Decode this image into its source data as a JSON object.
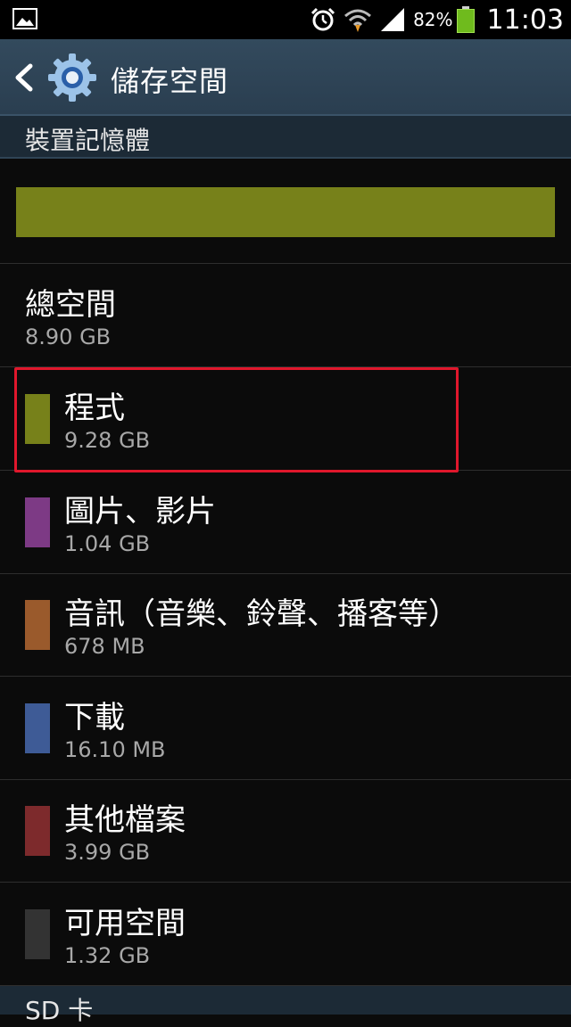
{
  "status_bar": {
    "battery_percent": "82%",
    "time": "11:03",
    "icons": [
      "image-icon",
      "alarm-icon",
      "wifi-icon",
      "signal-icon",
      "battery-icon"
    ]
  },
  "action_bar": {
    "title": "儲存空間",
    "icons": [
      "back-icon",
      "gear-icon"
    ]
  },
  "device_memory": {
    "header": "裝置記憶體",
    "usage_bar_color": "#77811a",
    "total": {
      "label": "總空間",
      "value": "8.90 GB"
    },
    "items": [
      {
        "label": "程式",
        "value": "9.28 GB",
        "color": "#77811a"
      },
      {
        "label": "圖片、影片",
        "value": "1.04 GB",
        "color": "#7d3a85"
      },
      {
        "label": "音訊（音樂、鈴聲、播客等）",
        "value": "678 MB",
        "color": "#9a5a2c"
      },
      {
        "label": "下載",
        "value": "16.10 MB",
        "color": "#3e5b96"
      },
      {
        "label": "其他檔案",
        "value": "3.99 GB",
        "color": "#7d2a2c"
      },
      {
        "label": "可用空間",
        "value": "1.32 GB",
        "color": "#333333"
      }
    ]
  },
  "sd_card": {
    "header": "SD 卡"
  }
}
